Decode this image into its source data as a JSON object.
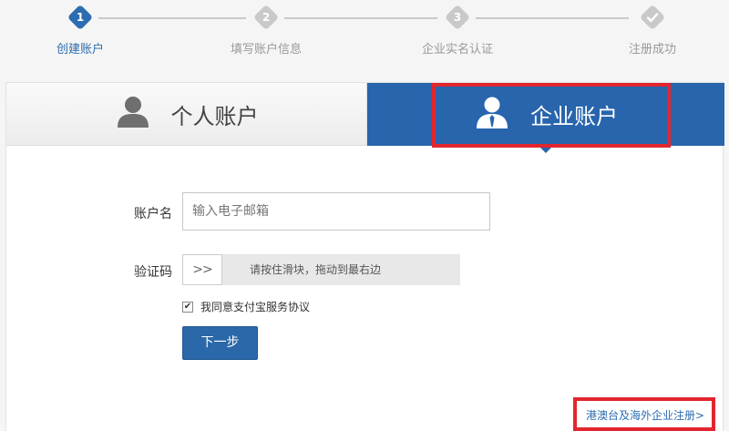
{
  "stepper": {
    "steps": [
      {
        "num": "1",
        "label": "创建账户",
        "state": "active"
      },
      {
        "num": "2",
        "label": "填写账户信息",
        "state": "inactive"
      },
      {
        "num": "3",
        "label": "企业实名认证",
        "state": "inactive"
      },
      {
        "num": "",
        "label": "注册成功",
        "state": "inactive",
        "icon": "check-icon"
      }
    ]
  },
  "tabs": {
    "personal": {
      "label": "个人账户",
      "icon": "person-icon"
    },
    "enterprise": {
      "label": "企业账户",
      "icon": "business-person-icon",
      "selected": true
    }
  },
  "form": {
    "account_label": "账户名",
    "account_placeholder": "输入电子邮箱",
    "captcha_label": "验证码",
    "slider_handle": ">>",
    "slider_text": "请按住滑块，拖动到最右边",
    "agree_prefix": "我同意",
    "agree_link": "支付宝服务协议",
    "agree_checked": true,
    "next_button": "下一步"
  },
  "footer": {
    "hk_link": "港澳台及海外企业注册>"
  },
  "colors": {
    "accent": "#2865ad",
    "highlight": "#e3262e",
    "inactive": "#c9c9c9"
  }
}
